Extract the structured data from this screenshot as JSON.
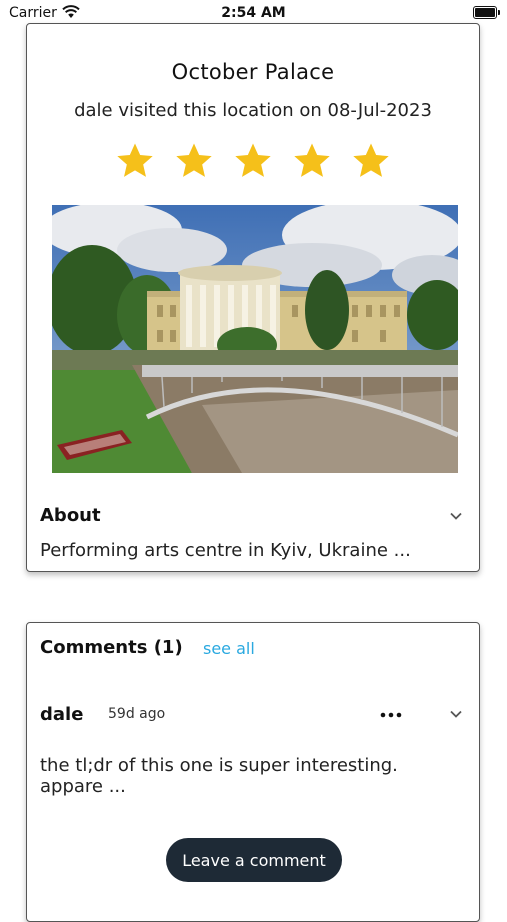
{
  "status": {
    "carrier": "Carrier",
    "time": "2:54 AM"
  },
  "location": {
    "name": "October Palace",
    "visit_text": "dale visited this location on 08-Jul-2023",
    "rating": 5,
    "rating_max": 5,
    "star_color": "#f5c01a"
  },
  "about": {
    "title": "About",
    "text": "Performing arts centre in Kyiv, Ukraine ..."
  },
  "comments": {
    "title": "Comments (1)",
    "see_all": "see all",
    "items": [
      {
        "user": "dale",
        "time_ago": "59d ago",
        "text": "the tl;dr of this one is super interesting. appare ..."
      }
    ],
    "leave_button": "Leave a comment"
  },
  "icons": {
    "wifi": "wifi-icon",
    "battery": "battery-icon",
    "star": "star-icon",
    "chevron": "chevron-down-icon",
    "more": "more-dots-icon"
  },
  "colors": {
    "link": "#2aa9e0",
    "button_bg": "#1e2a36"
  }
}
